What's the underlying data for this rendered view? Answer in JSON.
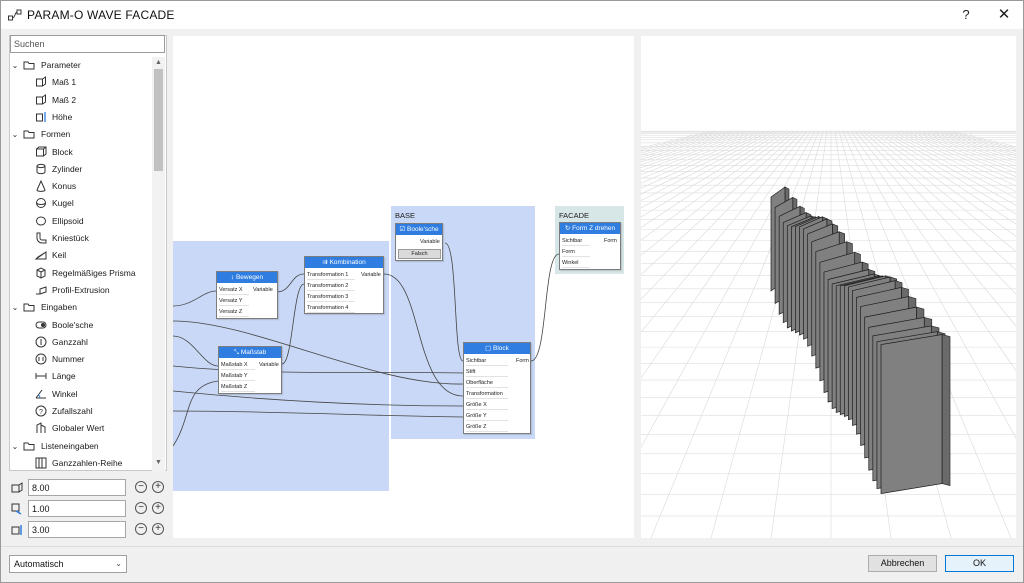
{
  "window": {
    "title": "PARAM-O WAVE FACADE",
    "help_label": "?",
    "close_label": "✕"
  },
  "search": {
    "placeholder": "Suchen"
  },
  "tree": {
    "items": [
      {
        "label": "Parameter",
        "type": "folder",
        "icon": "folder-icon"
      },
      {
        "label": "Maß 1",
        "type": "item",
        "icon": "dimension-icon"
      },
      {
        "label": "Maß 2",
        "type": "item",
        "icon": "dimension-icon"
      },
      {
        "label": "Höhe",
        "type": "item",
        "icon": "height-icon"
      },
      {
        "label": "Formen",
        "type": "folder",
        "icon": "folder-icon"
      },
      {
        "label": "Block",
        "type": "item",
        "icon": "block-icon"
      },
      {
        "label": "Zylinder",
        "type": "item",
        "icon": "cylinder-icon"
      },
      {
        "label": "Konus",
        "type": "item",
        "icon": "cone-icon"
      },
      {
        "label": "Kugel",
        "type": "item",
        "icon": "sphere-icon"
      },
      {
        "label": "Ellipsoid",
        "type": "item",
        "icon": "ellipsoid-icon"
      },
      {
        "label": "Kniestück",
        "type": "item",
        "icon": "elbow-icon"
      },
      {
        "label": "Keil",
        "type": "item",
        "icon": "wedge-icon"
      },
      {
        "label": "Regelmäßiges Prisma",
        "type": "item",
        "icon": "prism-icon"
      },
      {
        "label": "Profil-Extrusion",
        "type": "item",
        "icon": "extrusion-icon"
      },
      {
        "label": "Eingaben",
        "type": "folder",
        "icon": "folder-icon"
      },
      {
        "label": "Boole'sche",
        "type": "item",
        "icon": "boolean-icon"
      },
      {
        "label": "Ganzzahl",
        "type": "item",
        "icon": "integer-icon"
      },
      {
        "label": "Nummer",
        "type": "item",
        "icon": "number-icon"
      },
      {
        "label": "Länge",
        "type": "item",
        "icon": "length-icon"
      },
      {
        "label": "Winkel",
        "type": "item",
        "icon": "angle-icon"
      },
      {
        "label": "Zufallszahl",
        "type": "item",
        "icon": "random-icon"
      },
      {
        "label": "Globaler Wert",
        "type": "item",
        "icon": "global-value-icon"
      },
      {
        "label": "Listeneingaben",
        "type": "folder",
        "icon": "folder-icon"
      },
      {
        "label": "Ganzzahlen-Reihe",
        "type": "item",
        "icon": "integer-series-icon"
      }
    ]
  },
  "params": [
    {
      "value": "8.00",
      "icon": "dimension-icon"
    },
    {
      "value": "1.00",
      "icon": "dimension-icon"
    },
    {
      "value": "3.00",
      "icon": "height-icon"
    }
  ],
  "groups": {
    "base": "BASE",
    "facade": "FACADE"
  },
  "nodes": {
    "bewegen": {
      "title": "Bewegen",
      "inputs": [
        "Versatz X",
        "Versatz Y",
        "Versatz Z"
      ],
      "output": "Variable"
    },
    "massstab": {
      "title": "Maßstab",
      "inputs": [
        "Maßstab X",
        "Maßstab Y",
        "Maßstab Z"
      ],
      "output": "Variable"
    },
    "kombination": {
      "title": "Kombination",
      "inputs": [
        "Transformation 1",
        "Transformation 2",
        "Transformation 3",
        "Transformation 4"
      ],
      "output": "Variable"
    },
    "boolesche": {
      "title": "Boole'sche",
      "output": "Variable",
      "value": "Falsch"
    },
    "block": {
      "title": "Block",
      "inputs": [
        "Sichtbar",
        "Stift",
        "Oberfläche",
        "Transformation",
        "Größe X",
        "Größe Y",
        "Größe Z"
      ],
      "output": "Form"
    },
    "formz": {
      "title": "Form Z drehen",
      "inputs": [
        "Sichtbar",
        "Form",
        "Winkel"
      ],
      "output": "Form"
    }
  },
  "footer": {
    "mode": "Automatisch",
    "cancel": "Abbrechen",
    "ok": "OK"
  },
  "colors": {
    "accent": "#2f7de1",
    "group": "#c8d8f6",
    "facade_group": "#d7e6e6",
    "panel_fill": "#808080"
  }
}
